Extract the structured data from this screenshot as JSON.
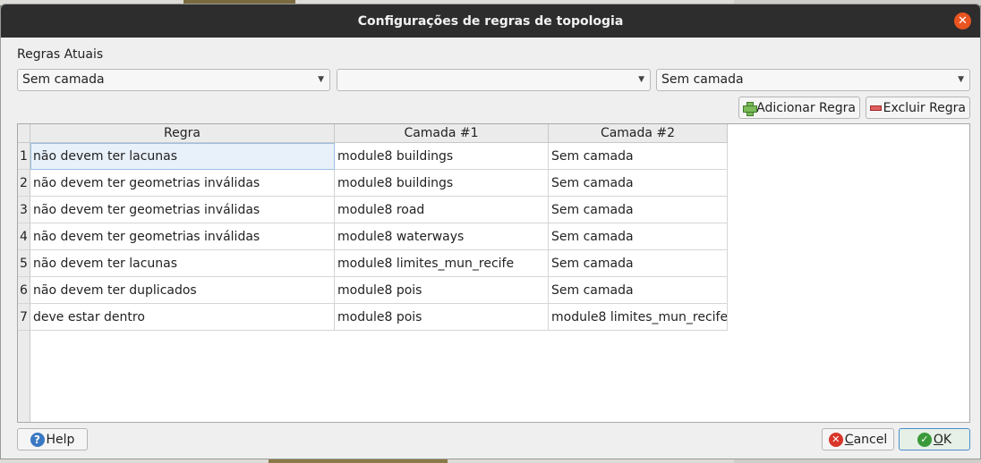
{
  "dialog": {
    "title": "Configurações de regras de topologia",
    "close_icon": "close-icon"
  },
  "rules_section": {
    "label": "Regras Atuais"
  },
  "combos": {
    "layer1": "Sem camada",
    "rule": "",
    "layer2": "Sem camada"
  },
  "buttons": {
    "add_rule": "Adicionar Regra",
    "delete_rule": "Excluir Regra",
    "help": "Help",
    "cancel_first": "C",
    "cancel_rest": "ancel",
    "ok_first": "O",
    "ok_rest": "K"
  },
  "table": {
    "columns": [
      "Regra",
      "Camada #1",
      "Camada #2"
    ],
    "rows": [
      {
        "num": "1",
        "rule": "não devem ter lacunas",
        "layer1": "module8 buildings",
        "layer2": "Sem camada"
      },
      {
        "num": "2",
        "rule": "não devem ter geometrias inválidas",
        "layer1": "module8 buildings",
        "layer2": "Sem camada"
      },
      {
        "num": "3",
        "rule": "não devem ter geometrias inválidas",
        "layer1": "module8 road",
        "layer2": "Sem camada"
      },
      {
        "num": "4",
        "rule": "não devem ter geometrias inválidas",
        "layer1": "module8 waterways",
        "layer2": "Sem camada"
      },
      {
        "num": "5",
        "rule": "não devem ter lacunas",
        "layer1": "module8 limites_mun_recife",
        "layer2": "Sem camada"
      },
      {
        "num": "6",
        "rule": "não devem ter duplicados",
        "layer1": "module8 pois",
        "layer2": "Sem camada"
      },
      {
        "num": "7",
        "rule": "deve estar dentro",
        "layer1": "module8 pois",
        "layer2": "module8 limites_mun_recife"
      }
    ]
  },
  "colors": {
    "titlebar": "#2d2d2d",
    "close_button": "#e95420",
    "selection": "#e8f1fa"
  }
}
